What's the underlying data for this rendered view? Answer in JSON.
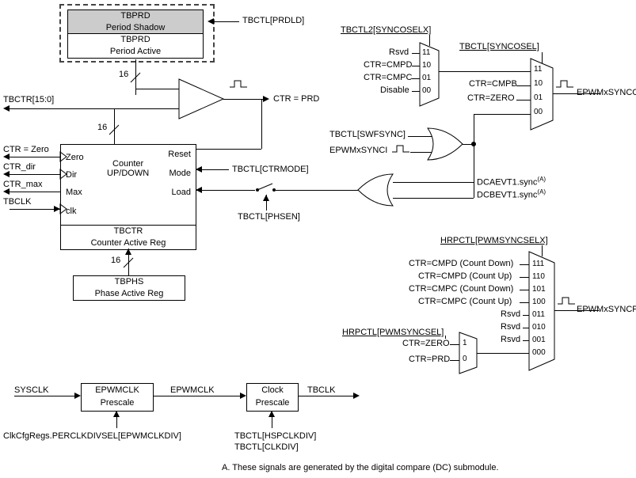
{
  "tbprd": {
    "shadow_title": "TBPRD",
    "shadow_sub": "Period Shadow",
    "active_title": "TBPRD",
    "active_sub": "Period Active",
    "bus_width": "16",
    "prdld_label": "TBCTL[PRDLD]"
  },
  "ctr_prd": "CTR = PRD",
  "tbctr_bus": "TBCTR[15:0]",
  "counter": {
    "title": "Counter",
    "sub": "UP/DOWN",
    "in_zero": "Zero",
    "in_dir": "Dir",
    "in_max": "Max",
    "in_clk": "clk",
    "out_reset": "Reset",
    "out_mode": "Mode",
    "out_load": "Load",
    "bus_width": "16"
  },
  "tbctr_reg": {
    "title": "TBCTR",
    "sub": "Counter Active Reg"
  },
  "tbphs": {
    "title": "TBPHS",
    "sub": "Phase Active Reg",
    "bus_width": "16"
  },
  "ctr_zero_in": "CTR = Zero",
  "ctr_dir_in": "CTR_dir",
  "ctr_max_in": "CTR_max",
  "tbclk_in": "TBCLK",
  "ctrmode": "TBCTL[CTRMODE]",
  "phsen": "TBCTL[PHSEN]",
  "sync_mux_top": {
    "title": "TBCTL2[SYNCOSELX]",
    "opt3": "Rsvd",
    "opt2": "CTR=CMPD",
    "opt1": "CTR=CMPC",
    "opt0": "Disable",
    "code3": "11",
    "code2": "10",
    "code1": "01",
    "code0": "00"
  },
  "sync_mux_right": {
    "title": "TBCTL[SYNCOSEL]",
    "opt3_spacer": "",
    "opt2": "CTR=CMPB",
    "opt1": "CTR=ZERO",
    "code3": "11",
    "code2": "10",
    "code1": "01",
    "code0": "00",
    "output": "EPWMxSYNCO"
  },
  "or_gate": {
    "in1": "TBCTL[SWFSYNC]",
    "in2": "EPWMxSYNCI"
  },
  "dc_or": {
    "in1": "DCAEVT1.sync",
    "in2": "DCBEVT1.sync",
    "note_ref": "(A)"
  },
  "hrpctl_mux": {
    "title": "HRPCTL[PWMSYNCSELX]",
    "opt7": "CTR=CMPD (Count Down)",
    "opt6": "CTR=CMPD (Count Up)",
    "opt5": "CTR=CMPC (Count Down)",
    "opt4": "CTR=CMPC (Count Up)",
    "opt3": "Rsvd",
    "opt2": "Rsvd",
    "opt1": "Rsvd",
    "code7": "111",
    "code6": "110",
    "code5": "101",
    "code4": "100",
    "code3": "011",
    "code2": "010",
    "code1": "001",
    "code0": "000",
    "output": "EPWMxSYNCPER"
  },
  "hrpctl_small": {
    "title": "HRPCTL[PWMSYNCSEL]",
    "opt1": "CTR=ZERO",
    "opt0": "CTR=PRD",
    "code1": "1",
    "code0": "0"
  },
  "clk_chain": {
    "sysclk": "SYSCLK",
    "epwmclk_prescale": "EPWMCLK\nPrescale",
    "epwmclk": "EPWMCLK",
    "clock_prescale": "Clock\nPrescale",
    "tbclk": "TBCLK",
    "clkdiv_reg": "ClkCfgRegs.PERCLKDIVSEL[EPWMCLKDIV]",
    "hspclkdiv": "TBCTL[HSPCLKDIV]",
    "clkdiv": "TBCTL[CLKDIV]"
  },
  "footnote": "A.  These signals are generated by the digital compare (DC) submodule."
}
